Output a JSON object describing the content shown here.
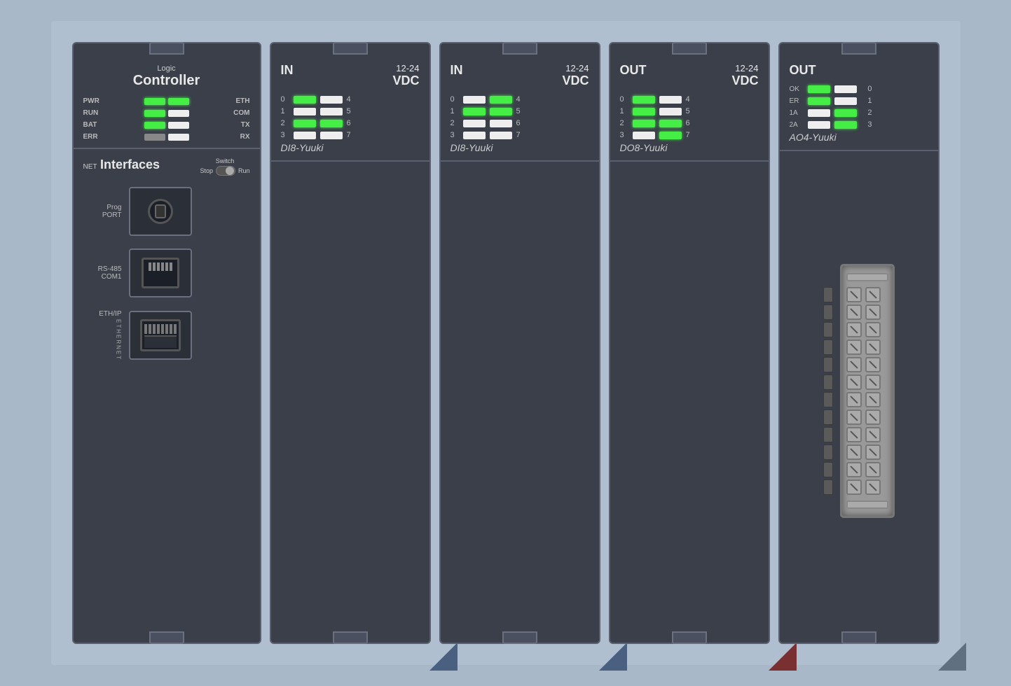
{
  "rack": {
    "modules": [
      {
        "id": "logic-controller",
        "type": "logic-controller",
        "title_small": "Logic",
        "title_large": "Controller",
        "indicators": [
          {
            "label": "PWR",
            "left_led": "green",
            "right_label": "ETH",
            "right_led": "green"
          },
          {
            "label": "RUN",
            "left_led": "green",
            "right_label": "COM",
            "right_led": "off"
          },
          {
            "label": "BAT",
            "left_led": "green",
            "right_label": "TX",
            "right_led": "off"
          },
          {
            "label": "ERR",
            "left_led": "dim",
            "right_label": "RX",
            "right_led": "off"
          }
        ],
        "net_title_small": "NET",
        "net_title_large": "Interfaces",
        "switch_label": "Switch",
        "switch_stop": "Stop",
        "switch_run": "Run",
        "ports": [
          {
            "label": "Prog\nPORT",
            "type": "prog"
          },
          {
            "label": "RS-485\nCOM1",
            "type": "rs485"
          },
          {
            "label": "ETH/IP",
            "side_label": "ETHERNET",
            "type": "eth"
          }
        ]
      },
      {
        "id": "di8-1",
        "type": "di8",
        "header_left": "IN",
        "voltage1": "12-24",
        "voltage2": "VDC",
        "channels": [
          {
            "num": "0",
            "left_led": "green",
            "right_num": "4",
            "right_led": "off"
          },
          {
            "num": "1",
            "left_led": "off",
            "right_num": "5",
            "right_led": "off"
          },
          {
            "num": "2",
            "left_led": "green",
            "right_num": "6",
            "right_led": "green"
          },
          {
            "num": "3",
            "left_led": "off",
            "right_num": "7",
            "right_led": "off"
          }
        ],
        "name": "DI8-Yuuki",
        "corner": "blue"
      },
      {
        "id": "di8-2",
        "type": "di8",
        "header_left": "IN",
        "voltage1": "12-24",
        "voltage2": "VDC",
        "channels": [
          {
            "num": "0",
            "left_led": "off",
            "right_num": "4",
            "right_led": "green"
          },
          {
            "num": "1",
            "left_led": "green",
            "right_num": "5",
            "right_led": "green"
          },
          {
            "num": "2",
            "left_led": "off",
            "right_num": "6",
            "right_led": "off"
          },
          {
            "num": "3",
            "left_led": "off",
            "right_num": "7",
            "right_led": "off"
          }
        ],
        "name": "DI8-Yuuki",
        "corner": "blue"
      },
      {
        "id": "do8-1",
        "type": "di8",
        "header_left": "OUT",
        "voltage1": "12-24",
        "voltage2": "VDC",
        "channels": [
          {
            "num": "0",
            "left_led": "green",
            "right_num": "4",
            "right_led": "off"
          },
          {
            "num": "1",
            "left_led": "green",
            "right_num": "5",
            "right_led": "off"
          },
          {
            "num": "2",
            "left_led": "green",
            "right_num": "6",
            "right_led": "green"
          },
          {
            "num": "3",
            "left_led": "off",
            "right_num": "7",
            "right_led": "green"
          }
        ],
        "name": "DO8-Yuuki",
        "corner": "red"
      },
      {
        "id": "ao4-1",
        "type": "ao4",
        "header_left": "OUT",
        "channels": [
          {
            "label": "OK",
            "left_led": "green",
            "right_label": "0",
            "right_led": "off"
          },
          {
            "label": "ER",
            "left_led": "green",
            "right_label": "1",
            "right_led": "off"
          },
          {
            "label": "1A",
            "left_led": "off",
            "right_label": "2",
            "right_led": "green"
          },
          {
            "label": "2A",
            "left_led": "off",
            "right_label": "3",
            "right_led": "green"
          }
        ],
        "name": "AO4-Yuuki",
        "corner": "gray",
        "has_terminals": true
      }
    ]
  }
}
